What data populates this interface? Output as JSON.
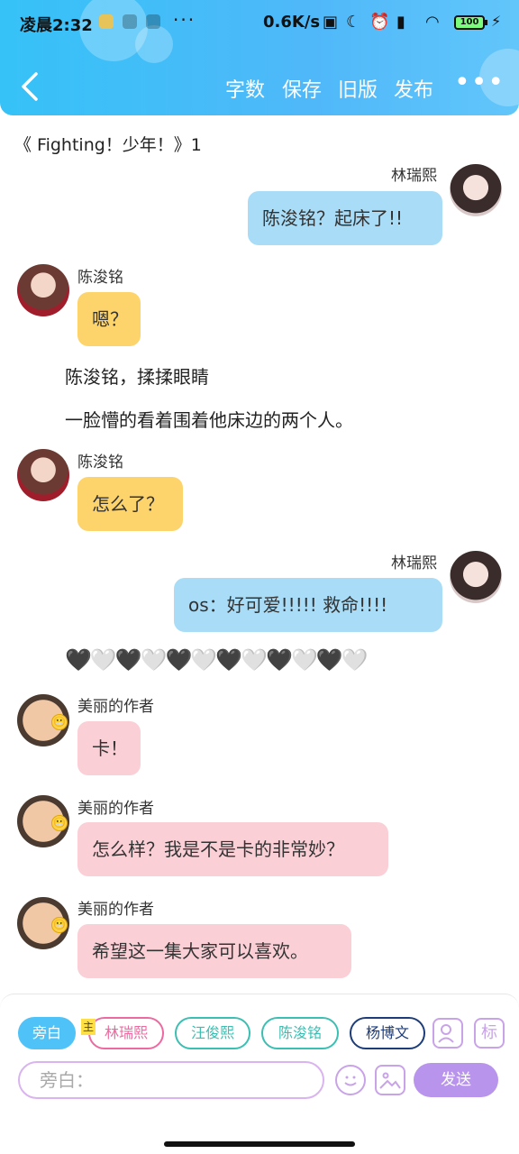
{
  "status_bar": {
    "time": "凌晨2:32",
    "dots": "···",
    "speed": "0.6K/s",
    "battery": "100"
  },
  "nav": {
    "word_count": "字数",
    "save": "保存",
    "old_version": "旧版",
    "publish": "发布",
    "more": "•••"
  },
  "title": "《 Fighting！少年！》1",
  "messages": [
    {
      "name": "林瑞熙",
      "text": "陈浚铭？起床了!!"
    },
    {
      "name": "陈浚铭",
      "text": "嗯？"
    },
    {
      "narration": "陈浚铭，揉揉眼睛"
    },
    {
      "narration": "一脸懵的看着围着他床边的两个人。"
    },
    {
      "name": "陈浚铭",
      "text": "怎么了？"
    },
    {
      "name": "林瑞熙",
      "text": "os：好可爱!!!!! 救命!!!!"
    },
    {
      "hearts": "🖤🤍🖤🤍🖤🤍🖤🤍🖤🤍🖤🤍"
    },
    {
      "name": "美丽的作者",
      "text": "卡！"
    },
    {
      "name": "美丽的作者",
      "text": "怎么样？我是不是卡的非常妙？"
    },
    {
      "name": "美丽的作者",
      "text": "希望这一集大家可以喜欢。"
    }
  ],
  "composer": {
    "roles": [
      "旁白",
      "林瑞熙",
      "汪俊熙",
      "陈浚铭",
      "杨博文"
    ],
    "host_tag": "主",
    "mark_label": "标",
    "placeholder": "旁白：",
    "send": "发送"
  },
  "colors": {
    "header": "#36c2f7",
    "bubble_blue": "#a9dcf6",
    "bubble_yellow": "#fdd46c",
    "bubble_pink": "#fbcfd6",
    "send": "#b894ec"
  },
  "icons": [
    "back-arrow-icon",
    "more-dots-icon",
    "role-avatar-icon",
    "emoji-icon",
    "image-icon",
    "nfc-icon",
    "moon-icon",
    "alarm-icon",
    "signal-icon",
    "wifi-icon",
    "battery-icon"
  ]
}
